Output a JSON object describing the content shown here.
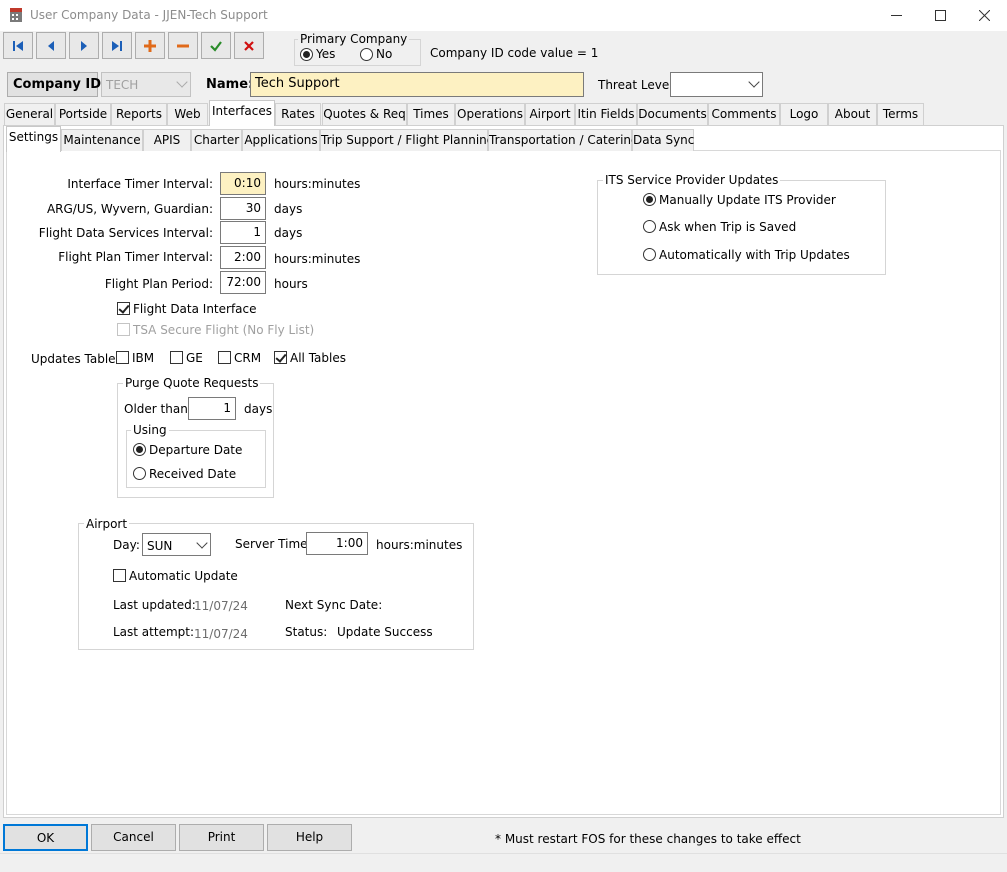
{
  "window": {
    "title": "User Company Data - JJEN-Tech Support"
  },
  "toolbar": {
    "first_icon": "first-record-icon",
    "prev_icon": "previous-record-icon",
    "next_icon": "next-record-icon",
    "last_icon": "last-record-icon",
    "add_icon": "add-icon",
    "delete_icon": "delete-icon",
    "save_icon": "checkmark-icon",
    "cancel_icon": "cancel-icon"
  },
  "primary_company": {
    "legend": "Primary Company",
    "yes": "Yes",
    "no": "No",
    "selected": "Yes"
  },
  "company_id_code": "Company ID code value = 1",
  "header": {
    "company_id_label": "Company ID:",
    "company_id_value": "TECH",
    "name_label": "Name:",
    "name_value": "Tech Support",
    "threat_level_label": "Threat Level:",
    "threat_level_value": ""
  },
  "main_tabs": [
    "General",
    "Portside",
    "Reports",
    "Web",
    "Interfaces",
    "Rates",
    "Quotes & Req",
    "Times",
    "Operations",
    "Airport",
    "Itin Fields",
    "Documents",
    "Comments",
    "Logo",
    "About",
    "Terms"
  ],
  "main_tab_active": "Interfaces",
  "sub_tabs": [
    "Settings",
    "Maintenance",
    "APIS",
    "Charter",
    "Applications",
    "Trip Support / Flight Planning",
    "Transportation / Catering",
    "Data Sync"
  ],
  "sub_tab_active": "Settings",
  "settings": {
    "interface_timer_label": "Interface Timer Interval:",
    "interface_timer_value": "0:10",
    "interface_timer_unit": "hours:minutes",
    "arg_label": "ARG/US, Wyvern, Guardian:",
    "arg_value": "30",
    "arg_unit": "days",
    "fds_label": "Flight Data Services Interval:",
    "fds_value": "1",
    "fds_unit": "days",
    "fp_timer_label": "Flight Plan Timer Interval:",
    "fp_timer_value": "2:00",
    "fp_timer_unit": "hours:minutes",
    "fp_period_label": "Flight Plan Period:",
    "fp_period_value": "72:00",
    "fp_period_unit": "hours",
    "flight_data_interface": "Flight Data Interface",
    "tsa_secure": "TSA Secure Flight (No Fly List)",
    "updates_table_label": "Updates Table:",
    "updates": {
      "ibm": "IBM",
      "ge": "GE",
      "crm": "CRM",
      "all": "All Tables"
    }
  },
  "purge": {
    "legend": "Purge Quote Requests",
    "older_label": "Older than:",
    "older_value": "1",
    "older_unit": "days",
    "using_legend": "Using",
    "departure": "Departure Date",
    "received": "Received Date"
  },
  "airport": {
    "legend": "Airport",
    "day_label": "Day:",
    "day_value": "SUN",
    "server_time_label": "Server Time:",
    "server_time_value": "1:00",
    "server_time_unit": "hours:minutes",
    "auto_update": "Automatic Update",
    "last_updated_label": "Last updated:",
    "last_updated_value": "11/07/24",
    "next_sync_label": "Next Sync Date:",
    "last_attempt_label": "Last attempt:",
    "last_attempt_value": "11/07/24",
    "status_label": "Status:",
    "status_value": "Update Success"
  },
  "its": {
    "legend": "ITS Service Provider Updates",
    "opt1": "Manually Update ITS Provider",
    "opt2": "Ask when Trip is Saved",
    "opt3": "Automatically with Trip Updates"
  },
  "footer": {
    "ok": "OK",
    "cancel": "Cancel",
    "print": "Print",
    "help": "Help",
    "note": "* Must restart FOS for these changes to take effect"
  }
}
